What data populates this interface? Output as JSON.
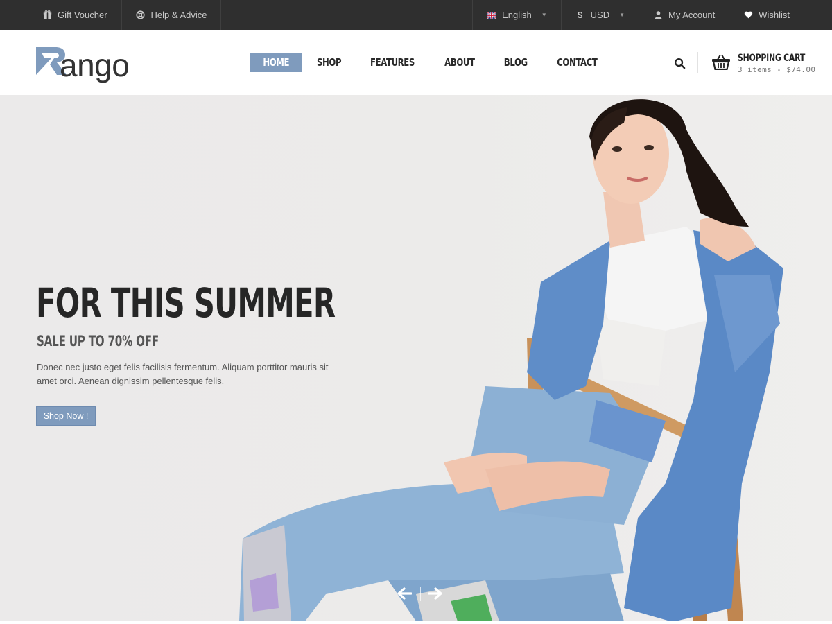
{
  "topbar": {
    "gift_voucher": "Gift Voucher",
    "help_advice": "Help & Advice",
    "language": "English",
    "currency": "USD",
    "account": "My Account",
    "wishlist": "Wishlist"
  },
  "header": {
    "logo_letter": "R",
    "logo_rest": "ango",
    "nav": [
      "HOME",
      "SHOP",
      "FEATURES",
      "ABOUT",
      "BLOG",
      "CONTACT"
    ],
    "active_nav": "HOME",
    "cart_title": "SHOPPING CART",
    "cart_summary": "3 items - $74.00"
  },
  "hero": {
    "title": "FOR THIS SUMMER",
    "subtitle": "SALE UP TO 70% OFF",
    "text": "Donec nec justo eget felis facilisis fermentum. Aliquam porttitor mauris sit amet orci. Aenean dignissim pellentesque felis.",
    "button": "Shop Now !"
  },
  "icons": {
    "gift": "gift-icon",
    "help": "lifebuoy-icon",
    "flag": "uk-flag-icon",
    "currency": "dollar-icon",
    "account": "user-icon",
    "wishlist": "heart-icon",
    "search": "search-icon",
    "cart": "basket-icon",
    "prev": "arrow-left-icon",
    "next": "arrow-right-icon"
  },
  "colors": {
    "accent": "#7f9bbd",
    "topbar_bg": "#2f2f2f",
    "text_dark": "#262626"
  }
}
